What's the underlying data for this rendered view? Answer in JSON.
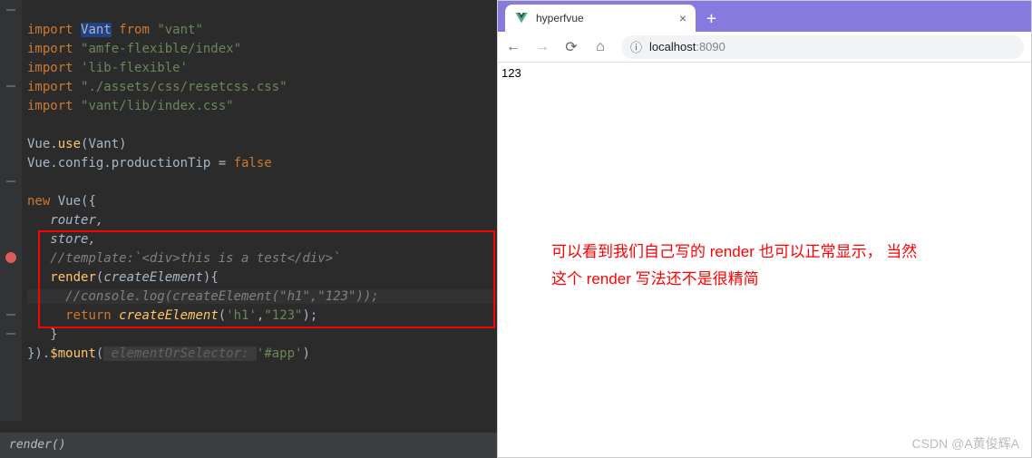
{
  "code": {
    "l1_kw": "import",
    "l1_ident": "Vant",
    "l1_from": "from",
    "l1_str": "\"vant\"",
    "l2_kw": "import",
    "l2_str": "\"amfe-flexible/index\"",
    "l3_kw": "import",
    "l3_str": "'lib-flexible'",
    "l4_kw": "import",
    "l4_str": "\"./assets/css/resetcss.css\"",
    "l5_kw": "import",
    "l5_str": "\"vant/lib/index.css\"",
    "l7_a": "Vue.",
    "l7_fn": "use",
    "l7_b": "(Vant)",
    "l8_a": "Vue.config.productionTip = ",
    "l8_kw": "false",
    "l10_kw": "new",
    "l10_b": " Vue({",
    "l11": "router,",
    "l12": "store,",
    "l13": "//template:`<div>this is a test</div>`",
    "l14_fn": "render",
    "l14_b": "(",
    "l14_param": "createElement",
    "l14_c": "){",
    "l15": "//console.log(createElement(\"h1\",\"123\"));",
    "l16_kw": "return",
    "l16_b": " ",
    "l16_fn": "createElement",
    "l16_c": "(",
    "l16_s1": "'h1'",
    "l16_d": ",",
    "l16_s2": "\"123\"",
    "l16_e": ");",
    "l17": "}",
    "l18_a": "}).",
    "l18_fn": "$mount",
    "l18_b": "(",
    "l18_hint": " elementOrSelector: ",
    "l18_s": "'#app'",
    "l18_c": ")"
  },
  "status": "render()",
  "browser": {
    "tab_title": "hyperfvue",
    "url_host": "localhost",
    "url_port": ":8090",
    "page_text": "123"
  },
  "annotation": {
    "line1": "可以看到我们自己写的 render 也可以正常显示， 当然",
    "line2": "这个 render 写法还不是很精简"
  },
  "watermark": "CSDN @A黄俊辉A"
}
